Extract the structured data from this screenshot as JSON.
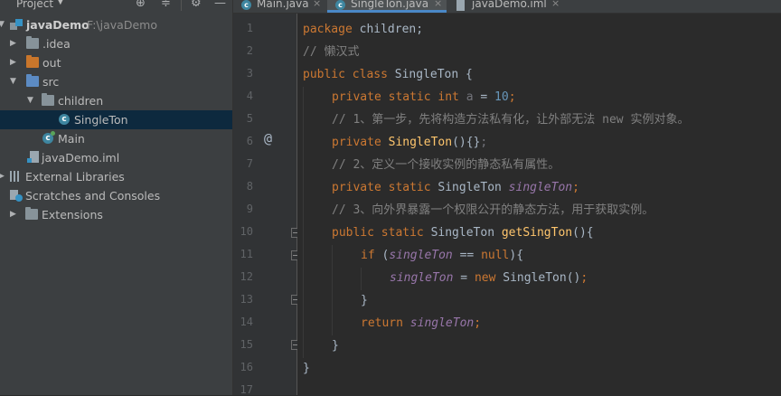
{
  "project_panel": {
    "title": "Project",
    "tree": [
      {
        "label": "javaDemo",
        "hint": "F:\\javaDemo",
        "icon": "module-icon",
        "expanded": true
      },
      {
        "label": ".idea",
        "icon": "folder-icon",
        "expanded": false
      },
      {
        "label": "out",
        "icon": "folder-orange-icon",
        "expanded": false
      },
      {
        "label": "src",
        "icon": "folder-blue-icon",
        "expanded": true
      },
      {
        "label": "children",
        "icon": "package-folder-icon",
        "expanded": true
      },
      {
        "label": "SingleTon",
        "icon": "java-class-icon",
        "selected": true
      },
      {
        "label": "Main",
        "icon": "java-main-class-icon"
      },
      {
        "label": "javaDemo.iml",
        "icon": "iml-file-icon"
      },
      {
        "label": "External Libraries",
        "icon": "libraries-icon",
        "expanded": false
      },
      {
        "label": "Scratches and Consoles",
        "icon": "scratches-icon"
      },
      {
        "label": "Extensions",
        "icon": "folder-icon",
        "expanded": false
      }
    ]
  },
  "tabs": [
    {
      "label": "Main.java",
      "active": false
    },
    {
      "label": "SingleTon.java",
      "active": true
    },
    {
      "label": "javaDemo.iml",
      "active": false
    }
  ],
  "editor": {
    "line_numbers": [
      "1",
      "2",
      "3",
      "4",
      "5",
      "6",
      "7",
      "8",
      "9",
      "10",
      "11",
      "12",
      "13",
      "14",
      "15",
      "16",
      "17"
    ],
    "gutter_marker": "@",
    "code": {
      "l1_kw": "package",
      "l1_rest": " children;",
      "l2": "// 懒汉式",
      "l3_kw": "public class",
      "l3_rest": " SingleTon {",
      "l4_kw": "private static int",
      "l4_var": "a",
      "l4_eq": " = ",
      "l4_num": "10",
      "l4_semi": ";",
      "l5": "// 1、第一步，先将构造方法私有化，让外部无法 new 实例对象。",
      "l6_kw": "private",
      "l6_fn": "SingleTon",
      "l6_rest": "(){}",
      "l6_semi": ";",
      "l7": "// 2、定义一个接收实例的静态私有属性。",
      "l8_kw": "private static",
      "l8_type": " SingleTon ",
      "l8_field": "singleTon",
      "l8_semi": ";",
      "l9": "// 3、向外界暴露一个权限公开的静态方法，用于获取实例。",
      "l10_kw": "public static",
      "l10_type": " SingleTon ",
      "l10_fn": "getSingTon",
      "l10_rest": "(){",
      "l11_kw": "if",
      "l11_open": " (",
      "l11_field": "singleTon",
      "l11_eq": " == ",
      "l11_null": "null",
      "l11_rest": "){",
      "l12_field": "singleTon",
      "l12_eq": " = ",
      "l12_new": "new",
      "l12_rest": " SingleTon()",
      "l12_semi": ";",
      "l13": "}",
      "l14_kw": "return",
      "l14_field": "singleTon",
      "l14_semi": ";",
      "l15": "}",
      "l16": "}"
    }
  },
  "colors": {
    "keyword": "#cc7832",
    "comment": "#808080",
    "number": "#6897bb",
    "field": "#9876aa",
    "method": "#ffc66d",
    "text": "#a9b7c6",
    "selection": "#0d293e"
  }
}
